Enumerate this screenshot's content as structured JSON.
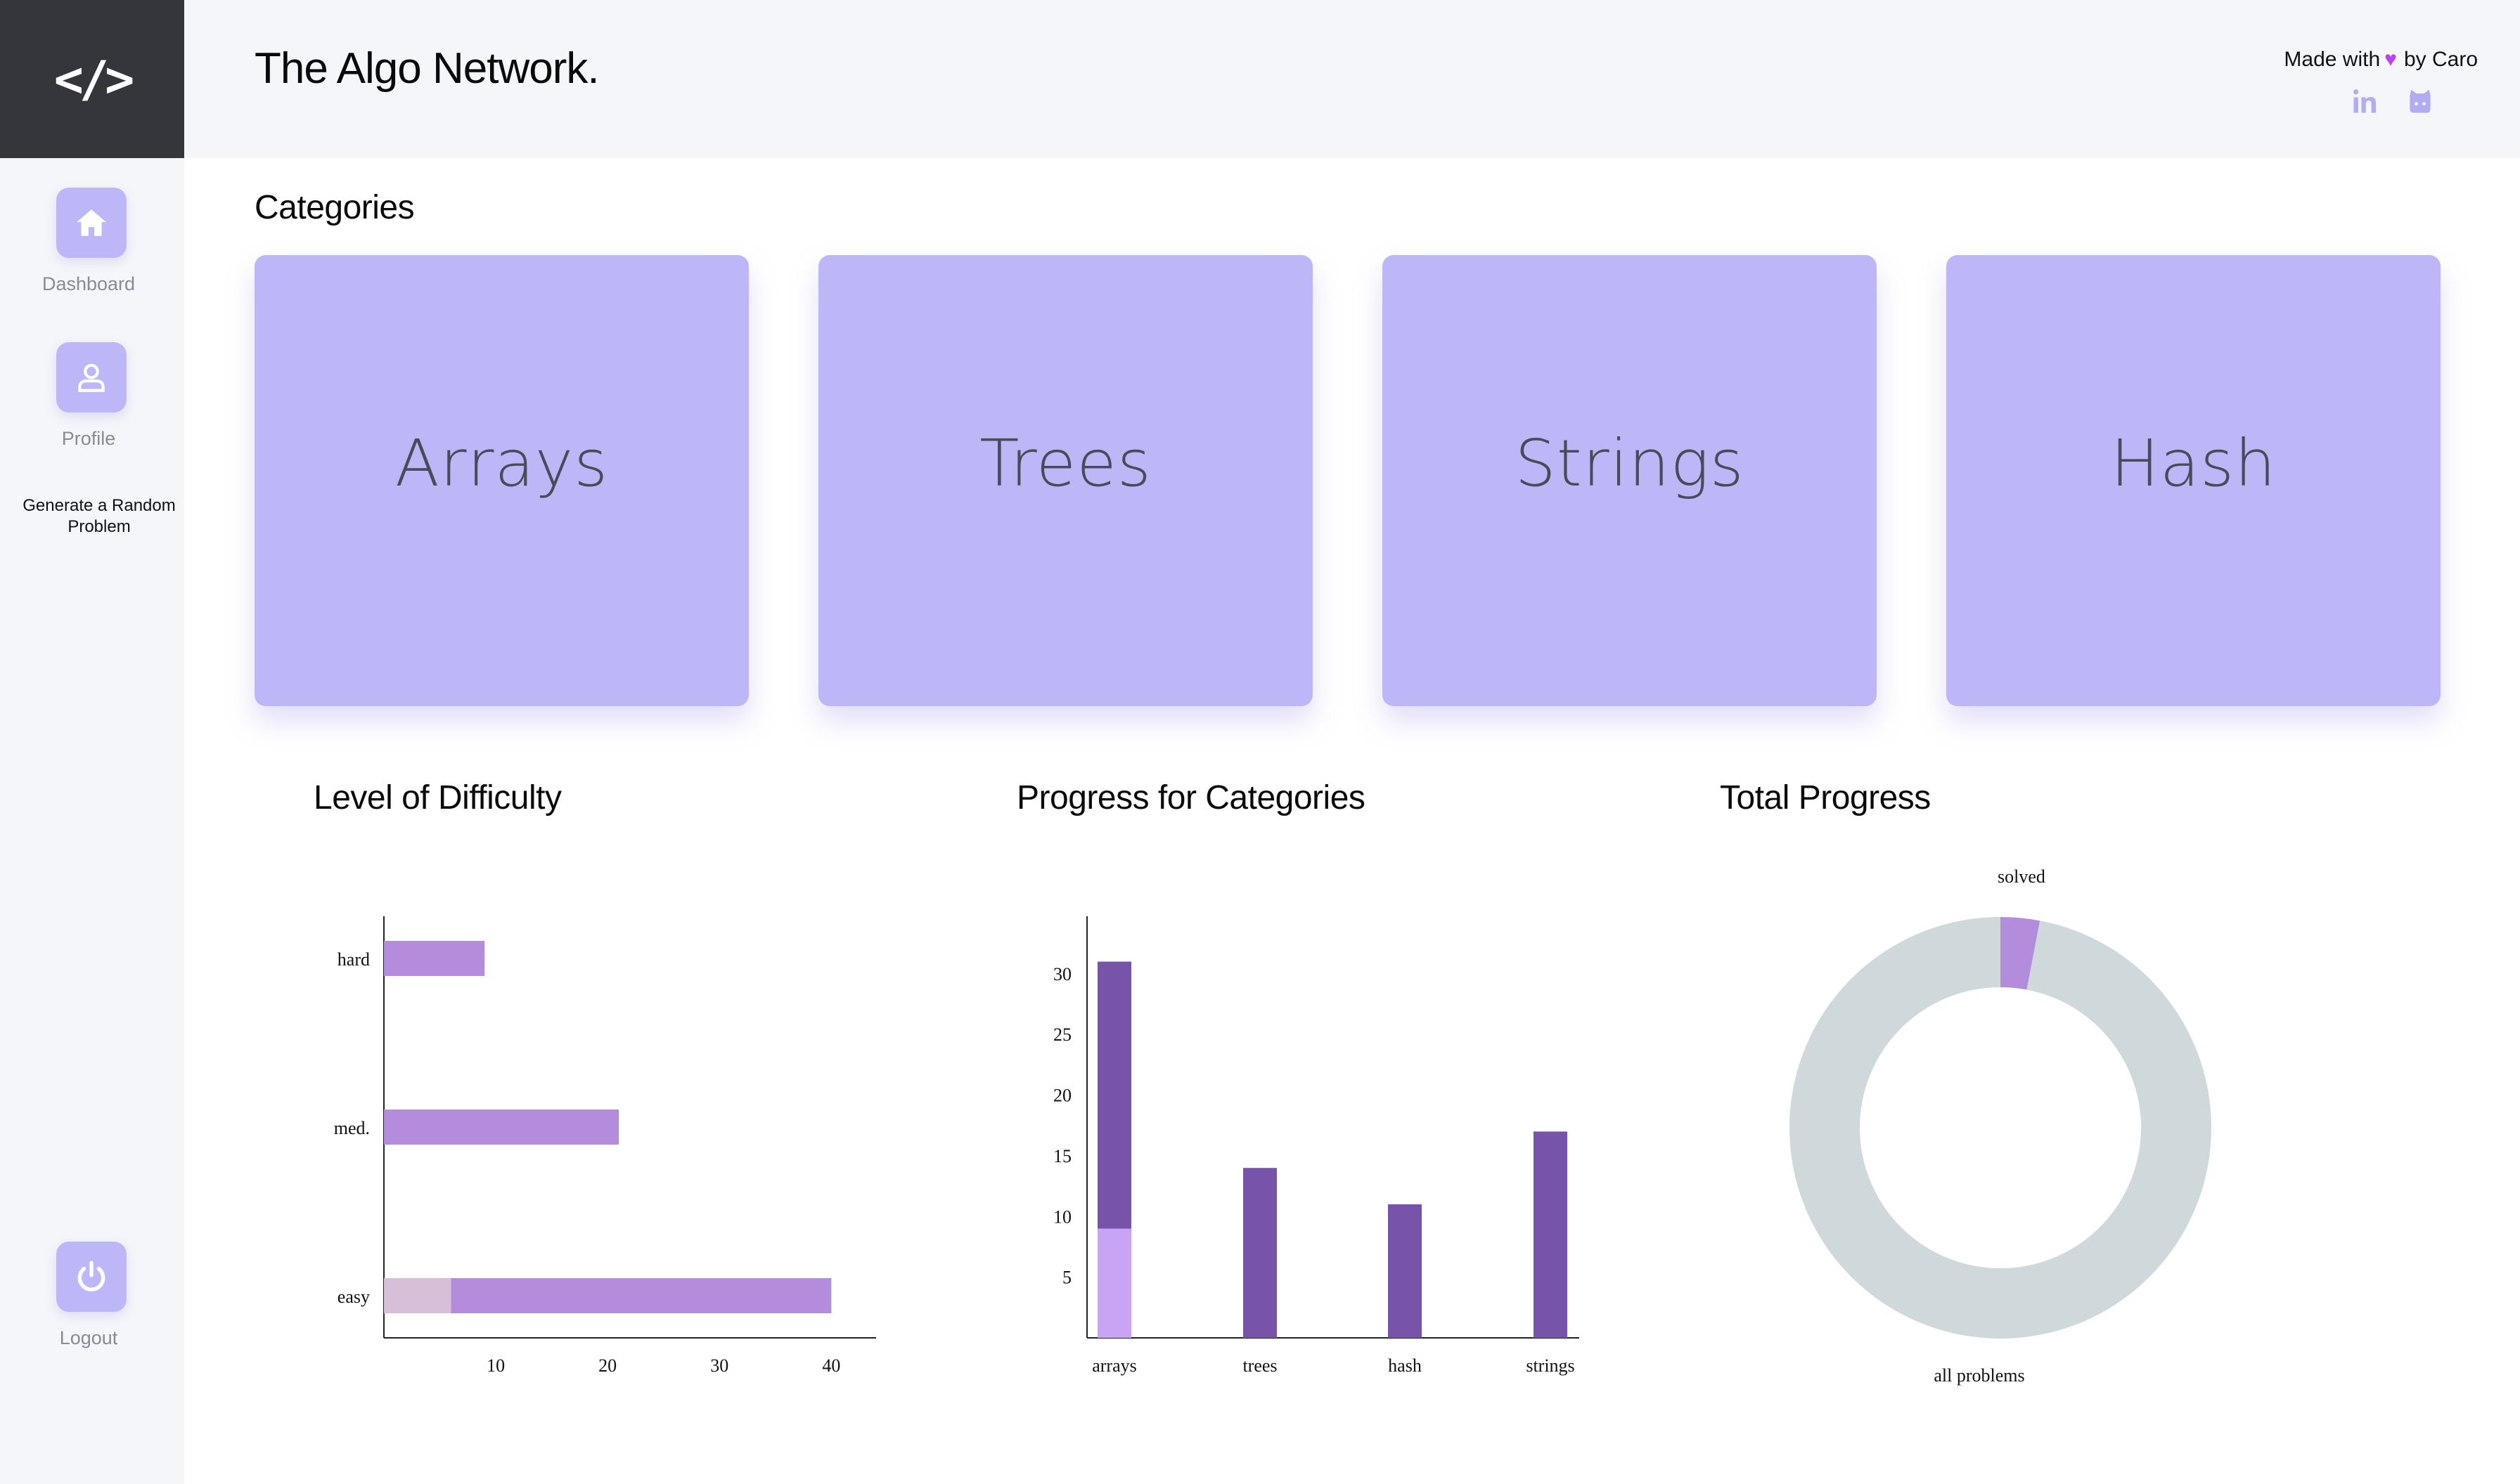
{
  "header": {
    "title": "The Algo Network.",
    "made_with_prefix": "Made with",
    "heart_icon": "heart-icon",
    "made_with_suffix": "by Caro",
    "social": [
      "linkedin-icon",
      "github-icon"
    ]
  },
  "logo": {
    "symbol": "</>"
  },
  "sidebar": {
    "items": [
      {
        "label": "Dashboard",
        "icon": "home-icon"
      },
      {
        "label": "Profile",
        "icon": "user-icon"
      }
    ],
    "random_problem": "Generate a Random Problem",
    "logout": {
      "label": "Logout",
      "icon": "power-icon"
    }
  },
  "categories": {
    "title": "Categories",
    "items": [
      "Arrays",
      "Trees",
      "Strings",
      "Hash"
    ]
  },
  "charts_titles": {
    "difficulty": "Level of Difficulty",
    "progress": "Progress for Categories",
    "total": "Total Progress"
  },
  "colors": {
    "accent": "#bdb7f7",
    "bar_light_purple": "#b48cdc",
    "bar_dark_purple": "#7853aa",
    "bar_lilac": "#c9a4f5",
    "bar_pink": "#d7bfd8",
    "donut_gray": "#cfd8da"
  },
  "chart_data": [
    {
      "type": "bar",
      "orientation": "horizontal",
      "categories": [
        "hard",
        "med.",
        "easy"
      ],
      "series": [
        {
          "values": [
            0,
            0,
            6
          ]
        },
        {
          "values": [
            9,
            21,
            34
          ]
        }
      ],
      "xticks": [
        10,
        20,
        30,
        40
      ],
      "xlim": [
        0,
        44
      ]
    },
    {
      "type": "bar",
      "categories": [
        "arrays",
        "trees",
        "hash",
        "strings"
      ],
      "series": [
        {
          "values": [
            9,
            0,
            0,
            0
          ]
        },
        {
          "values": [
            22,
            14,
            11,
            17
          ]
        }
      ],
      "yticks": [
        5,
        10,
        15,
        20,
        25,
        30
      ],
      "ylim": [
        0,
        33
      ]
    },
    {
      "type": "pie",
      "labels": [
        "solved",
        "all problems"
      ],
      "values": [
        3,
        97
      ]
    }
  ]
}
